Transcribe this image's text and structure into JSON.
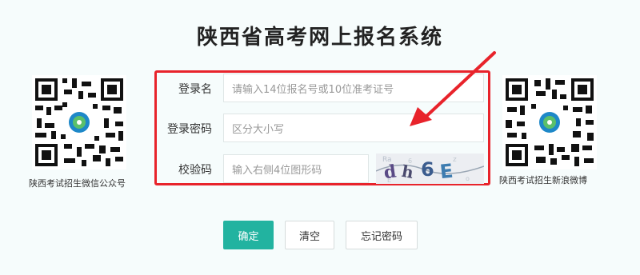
{
  "page": {
    "title": "陕西省高考网上报名系统"
  },
  "qr_left": {
    "caption": "陕西考试招生微信公众号"
  },
  "qr_right": {
    "caption": "陕西考试招生新浪微博"
  },
  "form": {
    "username": {
      "label": "登录名",
      "placeholder": "请输入14位报名号或10位准考证号"
    },
    "password": {
      "label": "登录密码",
      "placeholder": "区分大小写"
    },
    "captcha": {
      "label": "校验码",
      "placeholder": "输入右侧4位图形码",
      "image_text": "dh6E"
    }
  },
  "buttons": {
    "confirm": "确定",
    "clear": "清空",
    "forgot": "忘记密码"
  },
  "colors": {
    "accent": "#22b3a0",
    "highlight": "#e8232b"
  }
}
